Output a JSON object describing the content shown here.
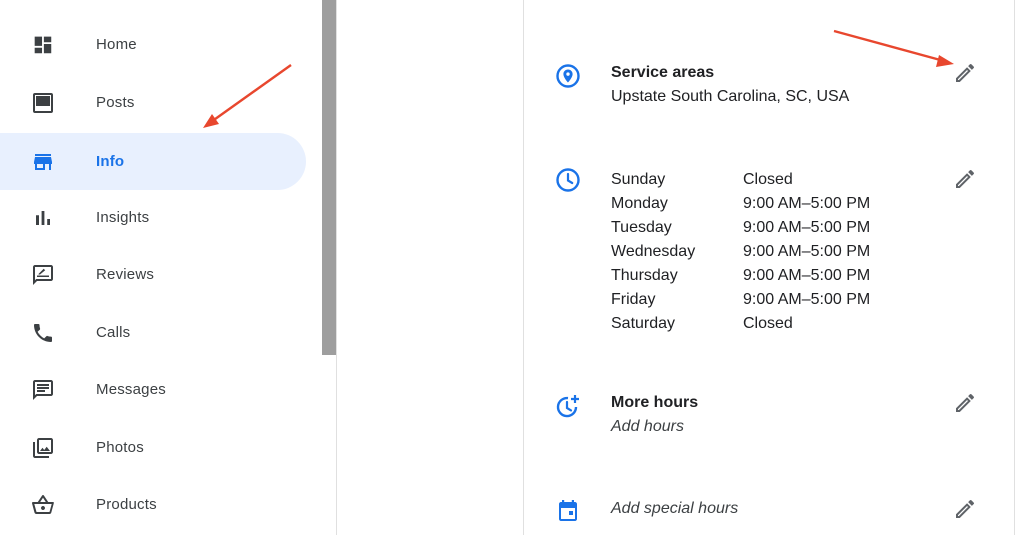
{
  "sidebar": {
    "items": [
      {
        "label": "Home",
        "icon": "dashboard-icon",
        "active": false
      },
      {
        "label": "Posts",
        "icon": "posts-icon",
        "active": false
      },
      {
        "label": "Info",
        "icon": "storefront-icon",
        "active": true
      },
      {
        "label": "Insights",
        "icon": "bar-chart-icon",
        "active": false
      },
      {
        "label": "Reviews",
        "icon": "rate-review-icon",
        "active": false
      },
      {
        "label": "Calls",
        "icon": "phone-icon",
        "active": false
      },
      {
        "label": "Messages",
        "icon": "chat-icon",
        "active": false
      },
      {
        "label": "Photos",
        "icon": "photo-library-icon",
        "active": false
      },
      {
        "label": "Products",
        "icon": "basket-icon",
        "active": false
      }
    ]
  },
  "info": {
    "service_areas": {
      "title": "Service areas",
      "value": "Upstate South Carolina, SC, USA"
    },
    "hours": [
      {
        "day": "Sunday",
        "time": "Closed"
      },
      {
        "day": "Monday",
        "time": "9:00 AM–5:00 PM"
      },
      {
        "day": "Tuesday",
        "time": "9:00 AM–5:00 PM"
      },
      {
        "day": "Wednesday",
        "time": "9:00 AM–5:00 PM"
      },
      {
        "day": "Thursday",
        "time": "9:00 AM–5:00 PM"
      },
      {
        "day": "Friday",
        "time": "9:00 AM–5:00 PM"
      },
      {
        "day": "Saturday",
        "time": "Closed"
      }
    ],
    "more_hours": {
      "title": "More hours",
      "value": "Add hours"
    },
    "special_hours": {
      "value": "Add special hours"
    }
  },
  "colors": {
    "accent": "#1a73e8",
    "active_bg": "#e8f0fe",
    "annotation_arrow": "#e8472e"
  }
}
